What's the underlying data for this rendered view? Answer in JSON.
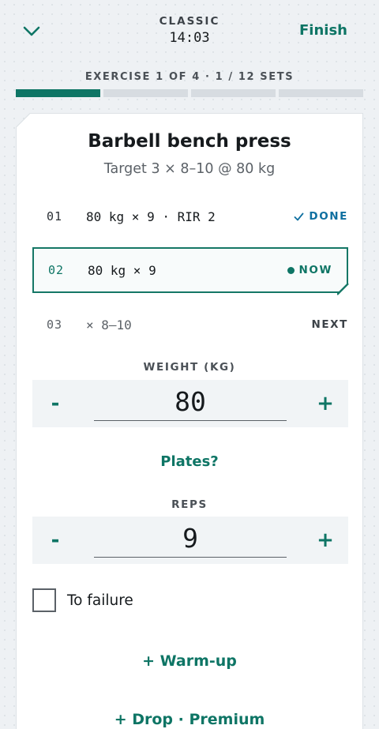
{
  "header": {
    "mode": "CLASSIC",
    "timer": "14:03",
    "finish_label": "Finish"
  },
  "progress": {
    "label": "EXERCISE 1 OF 4 · 1 / 12 SETS",
    "segments_total": 4,
    "segments_active": 1
  },
  "exercise": {
    "title": "Barbell bench press",
    "target": "Target 3 × 8–10 @ 80 kg"
  },
  "sets": [
    {
      "num": "01",
      "desc": "80 kg × 9 · RIR 2",
      "status": "DONE",
      "icon": "check-icon"
    },
    {
      "num": "02",
      "desc": "80 kg × 9",
      "status": "NOW",
      "icon": "dot-icon"
    },
    {
      "num": "03",
      "desc": "× 8–10",
      "status": "NEXT"
    }
  ],
  "weight": {
    "label": "WEIGHT (KG)",
    "value": "80",
    "minus": "-",
    "plus": "+"
  },
  "plates_label": "Plates?",
  "reps": {
    "label": "REPS",
    "value": "9",
    "minus": "-",
    "plus": "+"
  },
  "failure_label": "To failure",
  "warmup_label": "+ Warm-up",
  "drop_label": "+ Drop · Premium",
  "colors": {
    "accent": "#0e7565",
    "done": "#0e6fa0",
    "background": "#eef1f4"
  }
}
